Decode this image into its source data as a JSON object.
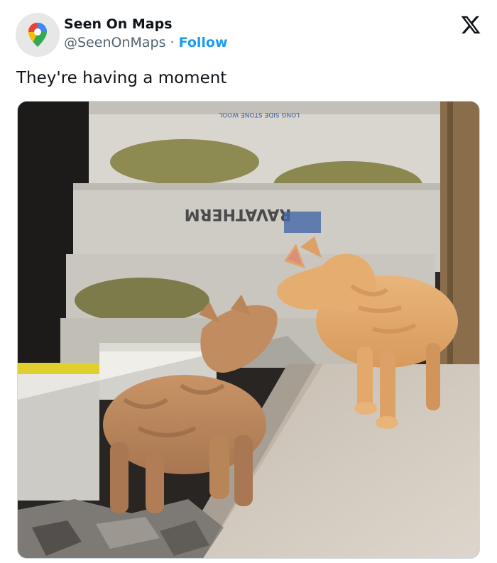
{
  "author": {
    "display_name": "Seen On Maps",
    "handle": "@SeenOnMaps",
    "separator": "·",
    "follow_label": "Follow",
    "avatar_icon": "maps-pin-icon"
  },
  "brand": {
    "logo_icon": "x-logo-icon"
  },
  "tweet": {
    "text": "They're having a moment"
  },
  "media": {
    "subject": "photo-two-ginger-cats",
    "package_label": "RAVATHERM",
    "package_top_label": "LONG SIDE STONE WOOL"
  },
  "colors": {
    "follow": "#1d9bf0",
    "text": "#0f1419",
    "secondary_text": "#536471",
    "cat_fur": "#e0a96a",
    "kitten_fur": "#b98559"
  }
}
